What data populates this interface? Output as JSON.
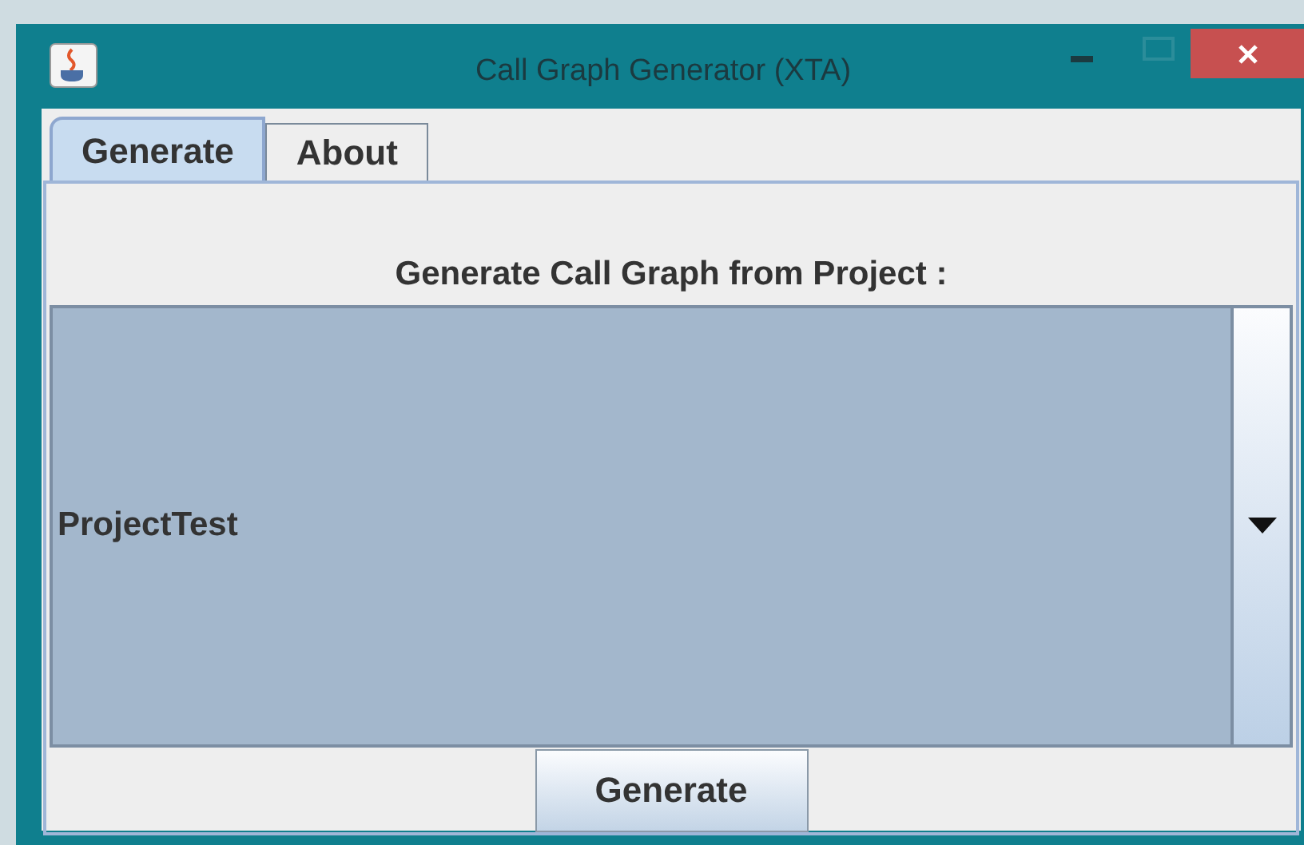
{
  "window": {
    "title": "Call Graph Generator (XTA)"
  },
  "tabs": [
    {
      "label": "Generate",
      "selected": true
    },
    {
      "label": "About",
      "selected": false
    }
  ],
  "prompt": "Generate Call Graph from Project :",
  "project_dropdown": {
    "value": "ProjectTest"
  },
  "button": "Generate"
}
